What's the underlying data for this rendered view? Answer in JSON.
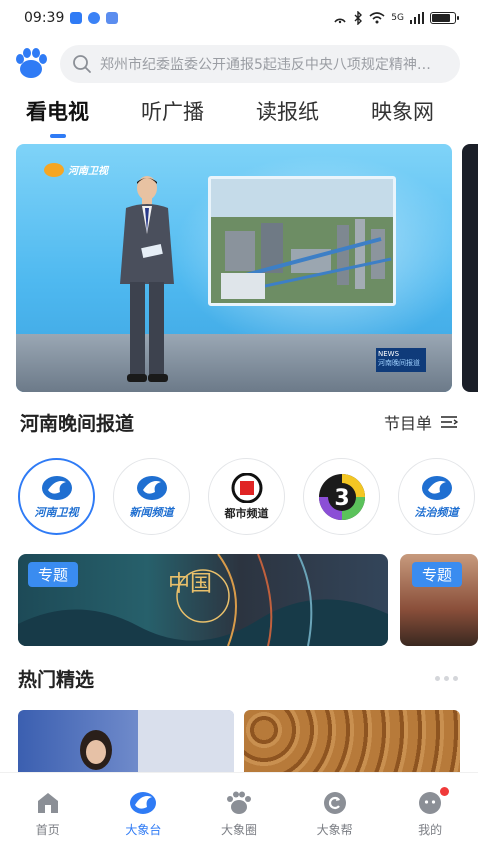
{
  "status_bar": {
    "time": "09:39",
    "signal_text": "5G",
    "battery_level": 0.85
  },
  "search": {
    "placeholder": "郑州市纪委监委公开通报5起违反中央八项规定精神…"
  },
  "tabs": [
    {
      "label": "看电视",
      "active": true
    },
    {
      "label": "听广播",
      "active": false
    },
    {
      "label": "读报纸",
      "active": false
    },
    {
      "label": "映象网",
      "active": false
    }
  ],
  "banner": {
    "logo_text": "河南卫视",
    "news_tag": "NEWS",
    "news_caption": "河南晚间报道"
  },
  "program": {
    "title": "河南晚间报道",
    "schedule_label": "节目单"
  },
  "channels": [
    {
      "name": "河南卫视",
      "active": true
    },
    {
      "name": "新闻频道",
      "active": false
    },
    {
      "name": "都市频道",
      "active": false
    },
    {
      "name": "",
      "active": false
    },
    {
      "name": "法治频道",
      "active": false
    }
  ],
  "topics": {
    "main_badge": "专题",
    "side_badge": "专题",
    "art_text": "中国"
  },
  "hot": {
    "title": "热门精选"
  },
  "bottom_nav": [
    {
      "label": "首页",
      "icon": "home-icon",
      "active": false
    },
    {
      "label": "大象台",
      "icon": "elephant-icon",
      "active": true
    },
    {
      "label": "大象圈",
      "icon": "paw-icon",
      "active": false
    },
    {
      "label": "大象帮",
      "icon": "help-icon",
      "active": false
    },
    {
      "label": "我的",
      "icon": "profile-icon",
      "active": false,
      "badge": true
    }
  ],
  "colors": {
    "accent": "#2f7bf5",
    "badge_red": "#f03a3a"
  }
}
